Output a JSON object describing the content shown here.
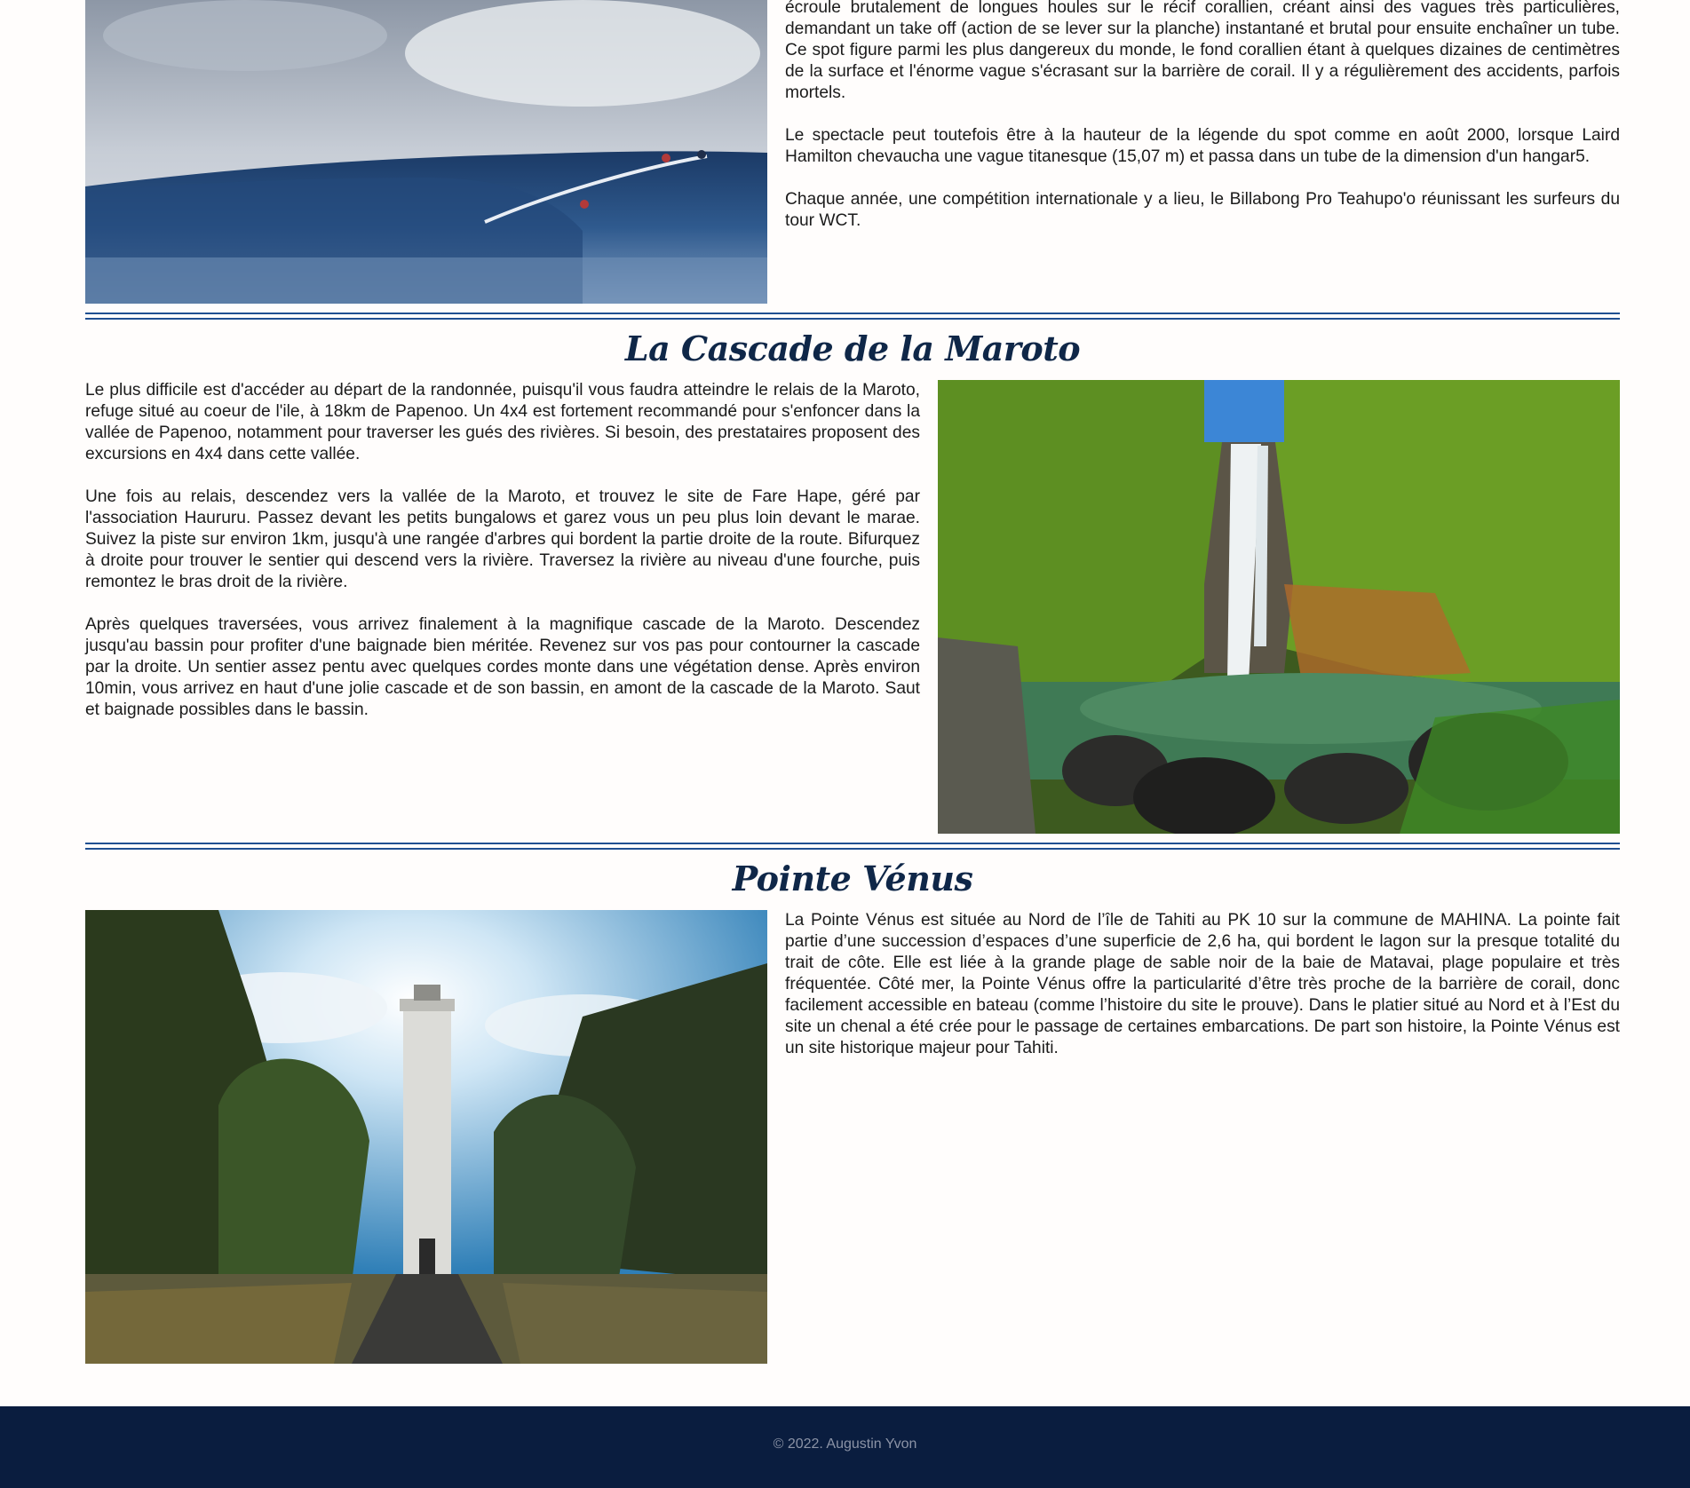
{
  "teahupoo": {
    "paragraphs": [
      "écroule brutalement de longues houles sur le récif corallien, créant ainsi des vagues très particulières, demandant un take off (action de se lever sur la planche) instantané et brutal pour ensuite enchaîner un tube. Ce spot figure parmi les plus dangereux du monde, le fond corallien étant à quelques dizaines de centimètres de la surface et l'énorme vague s'écrasant sur la barrière de corail. Il y a régulièrement des accidents, parfois mortels.",
      "Le spectacle peut toutefois être à la hauteur de la légende du spot comme en août 2000, lorsque Laird Hamilton chevaucha une vague titanesque (15,07 m) et passa dans un tube de la dimension d'un hangar5.",
      "Chaque année, une compétition internationale y a lieu, le Billabong Pro Teahupo'o réunissant les surfeurs du tour WCT."
    ]
  },
  "maroto": {
    "title": "La Cascade de la Maroto",
    "paragraphs": [
      "Le plus difficile est d'accéder au départ de la randonnée, puisqu'il vous faudra atteindre le relais de la Maroto, refuge situé au coeur de l'ile, à 18km de Papenoo. Un 4x4 est fortement recommandé pour s'enfoncer dans la vallée de Papenoo, notamment pour traverser les gués des rivières. Si besoin, des prestataires proposent des excursions en 4x4 dans cette vallée.",
      "Une fois au relais, descendez vers la vallée de la Maroto, et trouvez le site de Fare Hape, géré par l'association Haururu. Passez devant les petits bungalows et garez vous un peu plus loin devant le marae. Suivez la piste sur environ 1km, jusqu'à une rangée d'arbres qui bordent la partie droite de la route. Bifurquez à droite pour trouver le sentier qui descend vers la rivière. Traversez la rivière au niveau d'une fourche, puis remontez le bras droit de la rivière.",
      "Après quelques traversées, vous arrivez finalement à la magnifique cascade de la Maroto. Descendez jusqu'au bassin pour profiter d'une baignade bien méritée. Revenez sur vos pas pour contourner la cascade par la droite. Un sentier assez pentu avec quelques cordes monte dans une végétation dense. Après environ 10min, vous arrivez en haut d'une jolie cascade et de son bassin, en amont de la cascade de la Maroto. Saut et baignade possibles dans le bassin."
    ]
  },
  "venus": {
    "title": "Pointe Vénus",
    "paragraphs": [
      "La Pointe Vénus est située au Nord de l’île de Tahiti au PK 10 sur la commune de MAHINA. La pointe fait partie d’une succession d’espaces d’une superficie de 2,6 ha, qui bordent le lagon sur la presque totalité du trait de côte. Elle est liée à la grande plage de sable noir de la baie de Matavai, plage populaire et très fréquentée. Côté mer, la Pointe Vénus offre la particularité d’être très proche de la barrière de corail, donc facilement accessible en bateau (comme l’histoire du site le prouve). Dans le platier situé au Nord et à l’Est du site un chenal a été crée pour le passage de certaines embarcations. De part son histoire, la Pointe Vénus est un site historique majeur pour Tahiti."
    ]
  },
  "footer": {
    "copyright": "© 2022. Augustin Yvon"
  },
  "colors": {
    "accent": "#1f4f91",
    "title": "#0f2748",
    "footer_bg": "#0a1d3f"
  }
}
